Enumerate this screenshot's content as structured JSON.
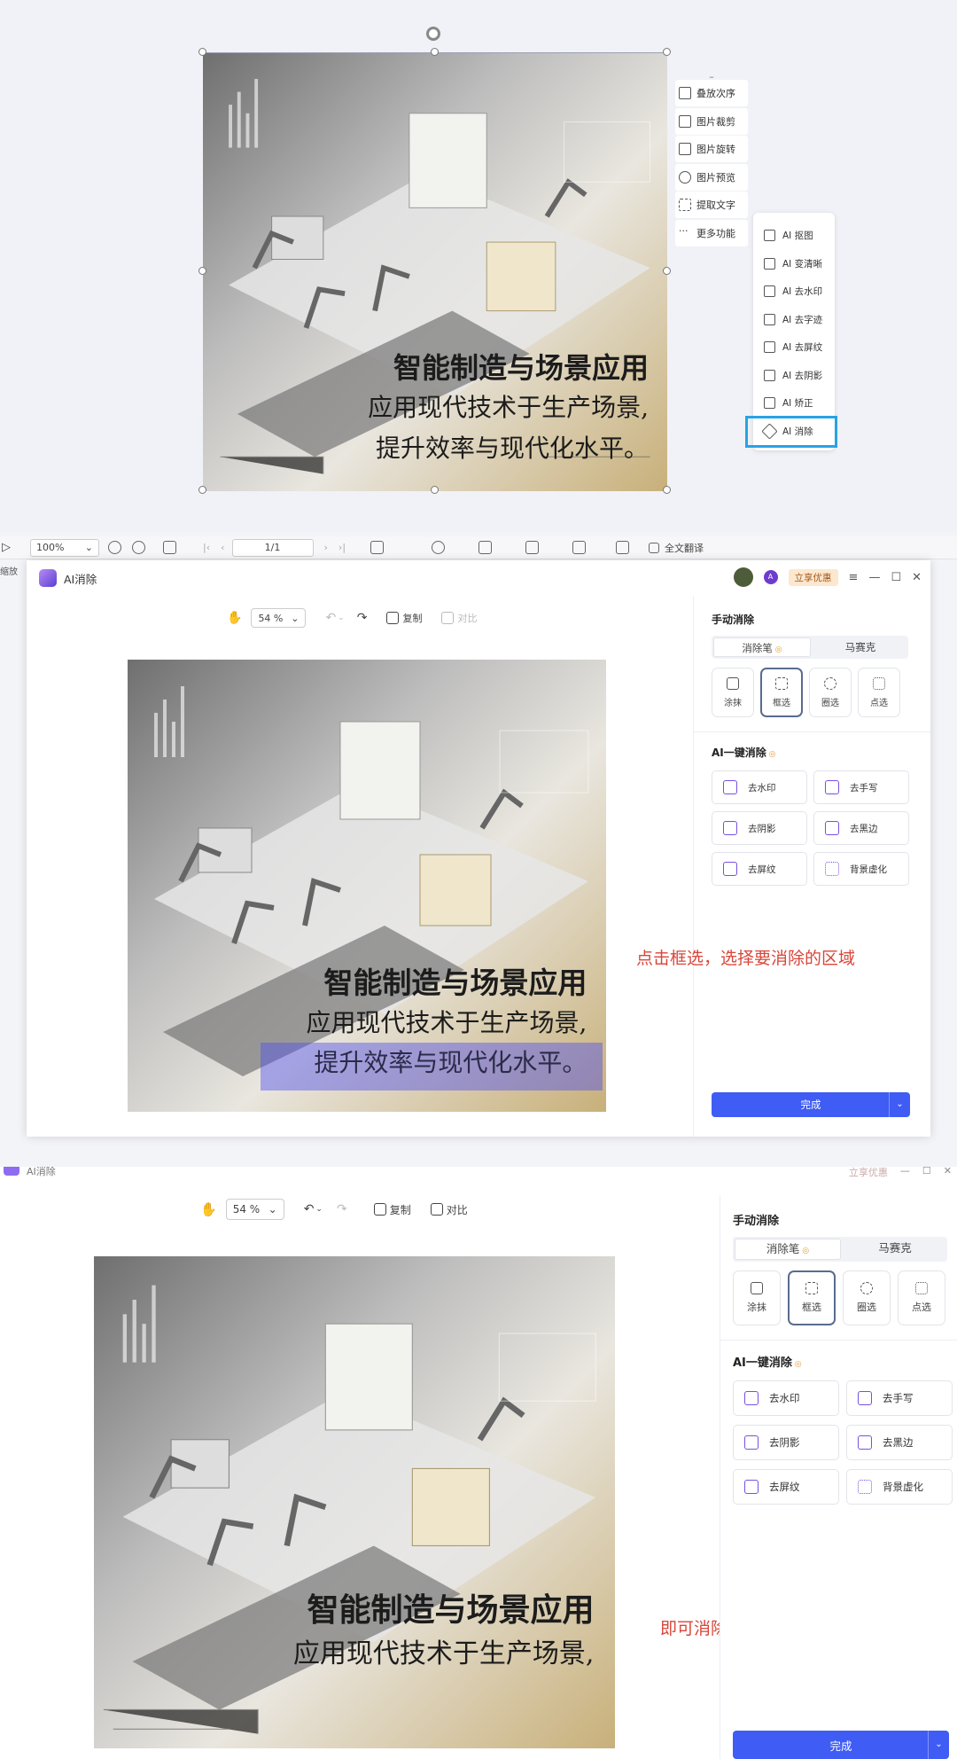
{
  "colors": {
    "accent": "#3f5cf4",
    "selection": "#27a3e6",
    "annotation": "#d9463a",
    "promo_bg": "#fde7cf"
  },
  "illustration": {
    "line1": "智能制造与场景应用",
    "line2": "应用现代技术于生产场景,",
    "line3": "提升效率与现代化水平。"
  },
  "context_menu": {
    "items": [
      {
        "label": "叠放次序",
        "icon": "layers-icon"
      },
      {
        "label": "图片裁剪",
        "icon": "crop-icon"
      },
      {
        "label": "图片旋转",
        "icon": "rotate-icon"
      },
      {
        "label": "图片预览",
        "icon": "zoom-icon"
      },
      {
        "label": "提取文字",
        "icon": "ocr-icon"
      },
      {
        "label": "更多功能",
        "icon": "more-icon"
      }
    ],
    "submenu": [
      {
        "label": "AI 抠图"
      },
      {
        "label": "AI 变清晰"
      },
      {
        "label": "AI 去水印"
      },
      {
        "label": "AI 去字迹"
      },
      {
        "label": "AI 去屏纹"
      },
      {
        "label": "AI 去阴影"
      },
      {
        "label": "AI 矫正"
      },
      {
        "label": "AI 消除"
      }
    ]
  },
  "viewer_toolbar": {
    "zoom": "100%",
    "page": "1/1",
    "translate": "全文翻译",
    "left_fragment": "缩放"
  },
  "ai_window": {
    "title": "AI消除",
    "promo": "立享优惠",
    "badge": "A",
    "zoom": "54 %",
    "copy": "复制",
    "compare": "对比",
    "manual_title": "手动消除",
    "tabs": [
      "消除笔",
      "马赛克"
    ],
    "modes": [
      "涂抹",
      "框选",
      "圈选",
      "点选"
    ],
    "ai_title": "AI一键消除",
    "ai_items": [
      "去水印",
      "去手写",
      "去阴影",
      "去黑边",
      "去屏纹",
      "背景虚化"
    ],
    "done": "完成"
  },
  "annotations": {
    "step1": "点击框选，选择要消除的区域",
    "step2": "即可消除"
  }
}
